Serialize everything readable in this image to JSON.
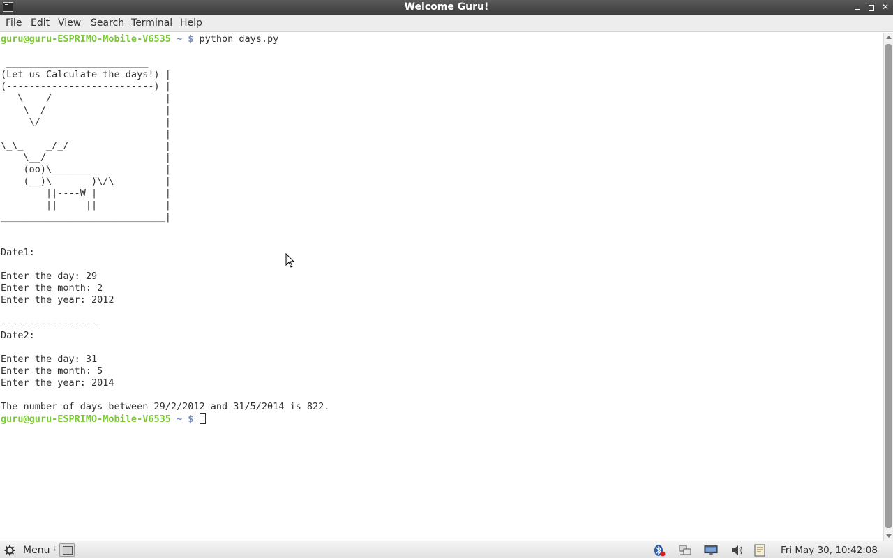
{
  "window": {
    "title": "Welcome Guru!"
  },
  "menubar": {
    "items": [
      {
        "label": "File",
        "accel": "F",
        "rest": "ile"
      },
      {
        "label": "Edit",
        "accel": "E",
        "rest": "dit"
      },
      {
        "label": "View",
        "accel": "V",
        "rest": "iew"
      },
      {
        "label": "Search",
        "accel": "S",
        "rest": "earch"
      },
      {
        "label": "Terminal",
        "accel": "T",
        "rest": "erminal"
      },
      {
        "label": "Help",
        "accel": "H",
        "rest": "elp"
      }
    ]
  },
  "terminal": {
    "prompt_user": "guru@guru-ESPRIMO-Mobile-V6535",
    "prompt_path": "~ $",
    "command": "python days.py",
    "art": [
      " _________________________",
      "(Let us Calculate the days!) |",
      "(--------------------------) |",
      "   \\    /                    |",
      "    \\  /                     |",
      "     \\/                      |",
      "                             |",
      "\\_\\_    _/_/                 |",
      "    \\__/                     |",
      "    (oo)\\_______             |",
      "    (__)\\       )\\/\\         |",
      "        ||----W |            |",
      "        ||     ||            |",
      "_____________________________|"
    ],
    "date1_header": "Date1:",
    "date1_day": "Enter the day: 29",
    "date1_month": "Enter the month: 2",
    "date1_year": "Enter the year: 2012",
    "separator": "-----------------",
    "date2_header": "Date2:",
    "date2_day": "Enter the day: 31",
    "date2_month": "Enter the month: 5",
    "date2_year": "Enter the year: 2014",
    "result": "The number of days between 29/2/2012 and 31/5/2014 is 822."
  },
  "taskbar": {
    "menu_label": "Menu",
    "clock": "Fri May 30, 10:42:08 AM",
    "tray_icons": [
      "bluetooth-icon",
      "network-manager-icon",
      "network-icon",
      "volume-icon",
      "notes-icon"
    ]
  }
}
